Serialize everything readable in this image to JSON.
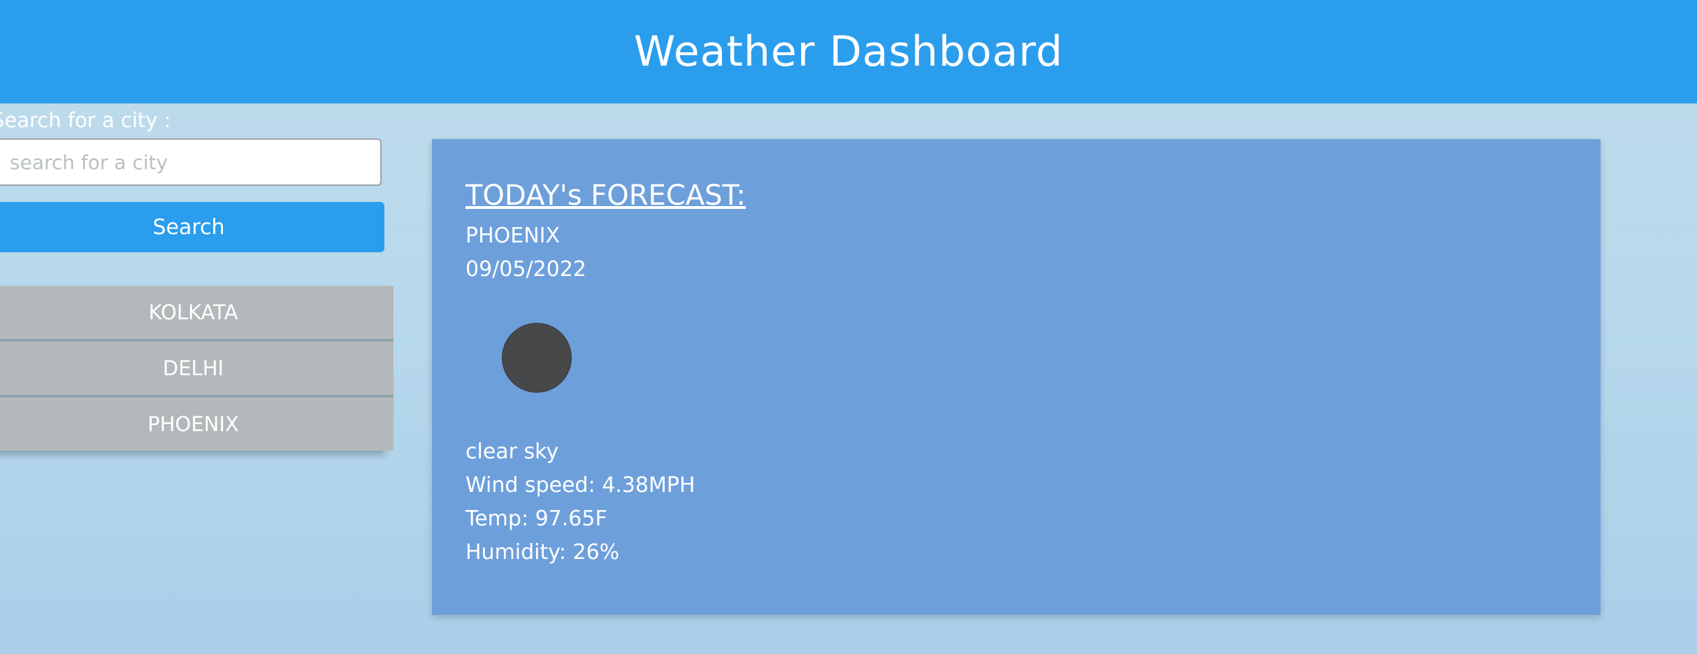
{
  "header": {
    "title": "Weather Dashboard"
  },
  "search": {
    "label": "Search for a city :",
    "placeholder": "search for a city",
    "value": "",
    "button_label": "Search"
  },
  "history": {
    "items": [
      {
        "label": "KOLKATA"
      },
      {
        "label": "DELHI"
      },
      {
        "label": "PHOENIX"
      }
    ]
  },
  "forecast": {
    "heading": "TODAY's FORECAST:",
    "city": "PHOENIX",
    "date": "09/05/2022",
    "icon": "weather-condition-icon",
    "description": "clear sky",
    "wind": "Wind speed: 4.38MPH",
    "temp": "Temp: 97.65F",
    "humidity": "Humidity: 26%"
  },
  "colors": {
    "header_bg": "#2b9ded",
    "card_bg": "#6d9fdb",
    "history_bg": "#b3b9ba"
  }
}
